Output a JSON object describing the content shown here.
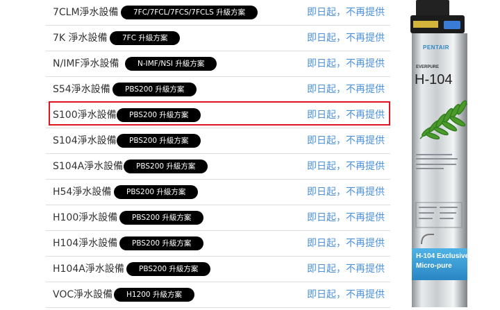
{
  "equipment_list": [
    {
      "name": "7CLM淨水設備",
      "upgrade": "7FC/7FCL/7FCS/7FCLS 升級方案",
      "status": "即日起，不再提供"
    },
    {
      "name": "7K 淨水設備",
      "upgrade": "7FC 升級方案",
      "status": "即日起，不再提供"
    },
    {
      "name": "N/IMF淨水設備",
      "upgrade": "N-IMF/NSI 升級方案",
      "status": "即日起，不再提供"
    },
    {
      "name": "S54淨水設備",
      "upgrade": "PBS200 升級方案",
      "status": "即日起，不再提供"
    },
    {
      "name": "S100淨水設備",
      "upgrade": "PBS200 升級方案",
      "status": "即日起，不再提供"
    },
    {
      "name": "S104淨水設備",
      "upgrade": "PBS200 升級方案",
      "status": "即日起，不再提供"
    },
    {
      "name": "S104A淨水設備",
      "upgrade": "PBS200 升級方案",
      "status": "即日起，不再提供"
    },
    {
      "name": "H54淨水設備",
      "upgrade": "PBS200 升級方案",
      "status": "即日起，不再提供"
    },
    {
      "name": "H100淨水設備",
      "upgrade": "PBS200 升級方案",
      "status": "即日起，不再提供"
    },
    {
      "name": "H104淨水設備",
      "upgrade": "PBS200 升級方案",
      "status": "即日起，不再提供"
    },
    {
      "name": "H104A淨水設備",
      "upgrade": "PBS200 升級方案",
      "status": "即日起，不再提供"
    },
    {
      "name": "VOC淨水設備",
      "upgrade": "H1200 升級方案",
      "status": "即日起，不再提供"
    }
  ],
  "product": {
    "brand": "PENTAIR",
    "line": "EVERPURE",
    "model": "H-104",
    "tagline_1": "H-104 Exclusive",
    "tagline_2": "Micro-pure"
  },
  "colors": {
    "status_link": "#4a90d9",
    "highlight_border": "#e0141e",
    "badge_bg": "#000000"
  }
}
